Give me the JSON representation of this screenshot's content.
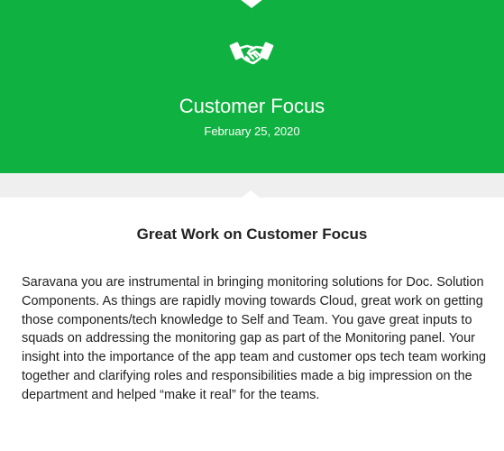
{
  "hero": {
    "icon": "handshake-icon",
    "title": "Customer Focus",
    "date": "February 25, 2020",
    "background_color": "#0fb140"
  },
  "card": {
    "title": "Great Work on Customer Focus",
    "body": "Saravana you are instrumental in bringing monitoring solutions for Doc. Solution Components. As things are rapidly moving towards Cloud, great work on getting those components/tech knowledge to Self and Team. You gave great inputs to squads on addressing the monitoring gap as part of the Monitoring panel. Your insight into the importance of the app team and customer ops tech team working together and clarifying roles and responsibilities made a big impression on the department and helped “make it real” for the teams."
  }
}
